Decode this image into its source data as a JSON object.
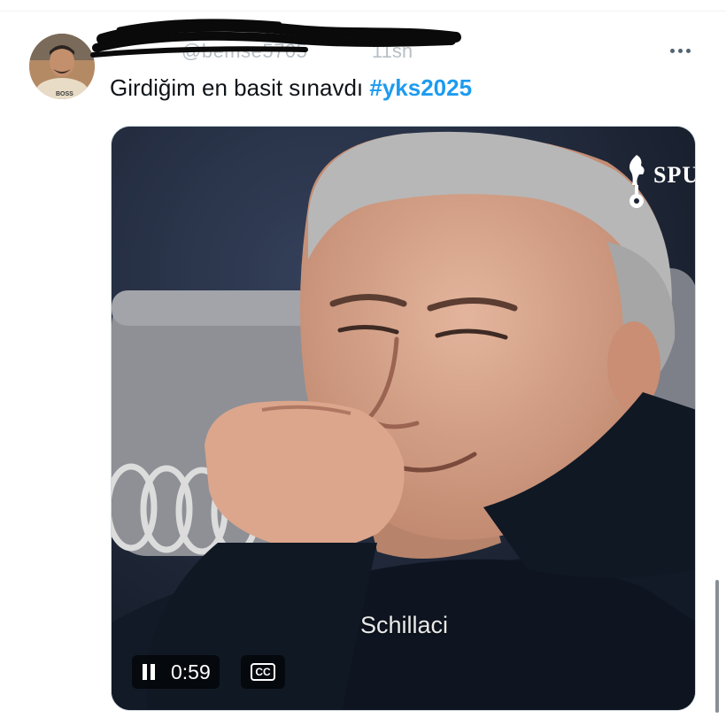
{
  "tweet": {
    "handle": "@bemse5705",
    "time": "11sn",
    "text": "Girdiğim en basit sınavdı ",
    "hashtag": "#yks2025",
    "avatar_badge": "BOSS"
  },
  "media": {
    "watermark": "SPU",
    "caption": "Schillaci",
    "time_remaining": "0:59",
    "cc_label": "CC",
    "state": "playing"
  },
  "icons": {
    "more": "more-horizontal-icon",
    "pause": "pause-icon",
    "captions": "closed-captions-icon"
  },
  "colors": {
    "hashtag": "#1d9bf0",
    "text": "#0f1419",
    "muted": "#536471"
  }
}
